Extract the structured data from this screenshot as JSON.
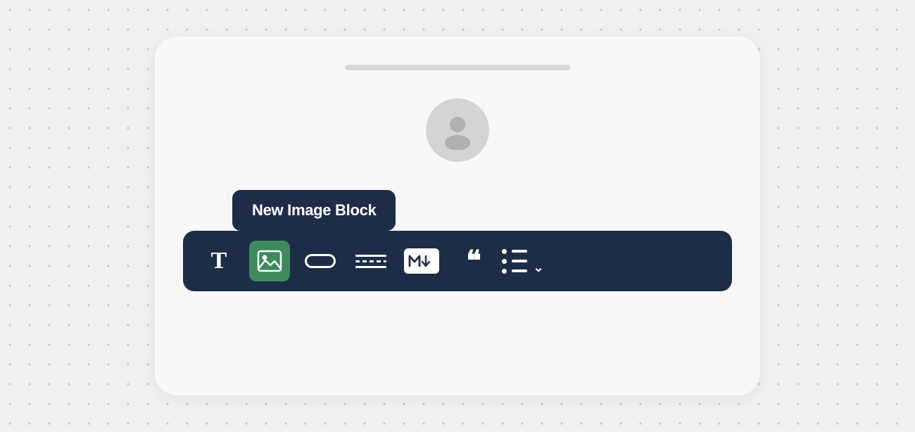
{
  "card": {
    "title_bar_aria": "title bar",
    "avatar_aria": "user avatar"
  },
  "tooltip": {
    "text": "New Image Block"
  },
  "toolbar": {
    "buttons": [
      {
        "id": "text-block",
        "label": "Text Block",
        "icon": "text-icon",
        "active": false
      },
      {
        "id": "image-block",
        "label": "Image Block",
        "icon": "image-icon",
        "active": true
      },
      {
        "id": "button-block",
        "label": "Button Block",
        "icon": "pill-icon",
        "active": false
      },
      {
        "id": "divider-block",
        "label": "Divider Block",
        "icon": "divider-icon",
        "active": false
      },
      {
        "id": "markdown-block",
        "label": "Markdown Block",
        "icon": "markdown-icon",
        "active": false
      },
      {
        "id": "quote-block",
        "label": "Quote Block",
        "icon": "quote-icon",
        "active": false
      },
      {
        "id": "list-block",
        "label": "List Block",
        "icon": "list-icon",
        "active": false
      }
    ]
  },
  "background": {
    "dot_color": "#c8c8c8",
    "card_bg": "#f8f8f8"
  }
}
